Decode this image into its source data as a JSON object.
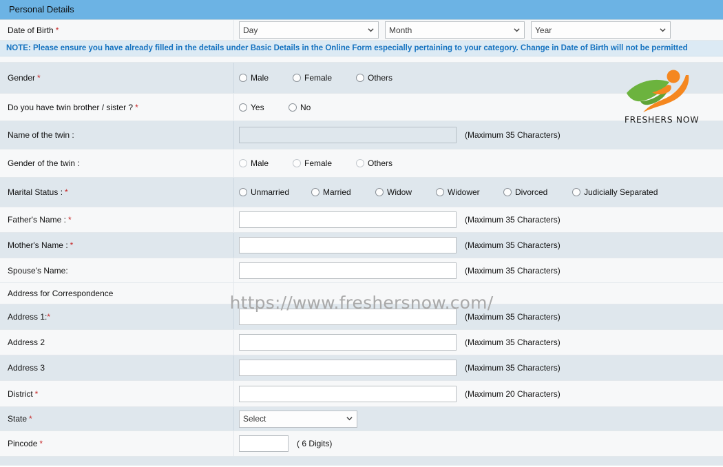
{
  "section": {
    "title": "Personal Details"
  },
  "note": {
    "text": "NOTE: Please ensure you have already filled in the details under Basic Details in the Online Form especially pertaining to your category. Change in Date of Birth will not be permitted",
    "color": "#1673c0",
    "background": "#dceaf4"
  },
  "theme": {
    "header_bg": "#6cb3e4",
    "row_light": "#f7f8f9",
    "row_shaded": "#dfe7ed",
    "required_star": "#c62828",
    "logo_green": "#6cb33e",
    "logo_orange": "#f5871f"
  },
  "watermark": {
    "text": "https://www.freshersnow.com/"
  },
  "logo": {
    "wordmark": "FRESHERS NOW",
    "mark_name": "freshersnow-leaf-figure-logo"
  },
  "rows": {
    "dob": {
      "label": "Date of Birth",
      "required": "*",
      "day": {
        "value": "Day",
        "options": [
          "Day"
        ]
      },
      "month": {
        "value": "Month",
        "options": [
          "Month"
        ]
      },
      "year": {
        "value": "Year",
        "options": [
          "Year"
        ]
      }
    },
    "gender": {
      "label": "Gender",
      "required": "*",
      "options": [
        "Male",
        "Female",
        "Others"
      ]
    },
    "twin": {
      "label": "Do you have twin brother / sister ?",
      "required": "*",
      "options": [
        "Yes",
        "No"
      ]
    },
    "twin_name": {
      "label": "Name of the twin :",
      "value": "",
      "hint": "(Maximum 35 Characters)",
      "disabled": true
    },
    "twin_gender": {
      "label": "Gender of the twin :",
      "options": [
        "Male",
        "Female",
        "Others"
      ],
      "disabled": true
    },
    "marital": {
      "label": "Marital Status :",
      "required": "*",
      "options": [
        "Unmarried",
        "Married",
        "Widow",
        "Widower",
        "Divorced",
        "Judicially Separated"
      ]
    },
    "father": {
      "label": "Father's Name :",
      "required": "*",
      "value": "",
      "hint": "(Maximum 35 Characters)"
    },
    "mother": {
      "label": "Mother's Name :",
      "required": "*",
      "value": "",
      "hint": "(Maximum 35 Characters)"
    },
    "spouse": {
      "label": "Spouse's Name:",
      "value": "",
      "hint": "(Maximum 35 Characters)"
    },
    "address_heading": {
      "label": "Address for Correspondence"
    },
    "address1": {
      "label": "Address 1:",
      "required": "*",
      "value": "",
      "hint": "(Maximum 35 Characters)"
    },
    "address2": {
      "label": "Address 2",
      "value": "",
      "hint": "(Maximum 35 Characters)"
    },
    "address3": {
      "label": "Address 3",
      "value": "",
      "hint": "(Maximum 35 Characters)"
    },
    "district": {
      "label": "District",
      "required": "*",
      "value": "",
      "hint": "(Maximum 20 Characters)"
    },
    "state": {
      "label": "State",
      "required": "*",
      "value": "Select",
      "options": [
        "Select"
      ]
    },
    "pincode": {
      "label": "Pincode",
      "required": "*",
      "value": "",
      "hint": "( 6 Digits)"
    }
  }
}
